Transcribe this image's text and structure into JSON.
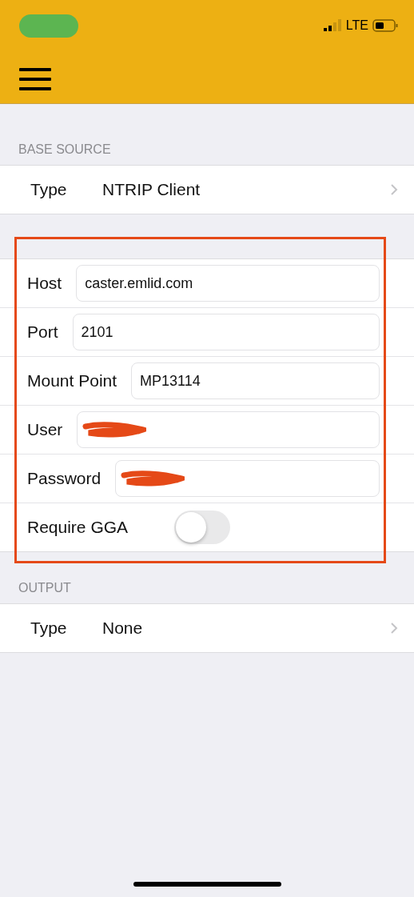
{
  "status_bar": {
    "network": "LTE"
  },
  "sections": [
    {
      "header": "BASE SOURCE",
      "row": {
        "label": "Type",
        "value": "NTRIP Client"
      }
    }
  ],
  "fields": [
    {
      "kind": "text",
      "label": "Host",
      "value": "caster.emlid.com"
    },
    {
      "kind": "text",
      "label": "Port",
      "value": "2101"
    },
    {
      "kind": "text",
      "label": "Mount Point",
      "value": "MP13114"
    },
    {
      "kind": "redacted",
      "label": "User"
    },
    {
      "kind": "redacted",
      "label": "Password"
    },
    {
      "kind": "switch",
      "label": "Require GGA",
      "on": false
    }
  ],
  "output": {
    "header": "OUTPUT",
    "row": {
      "label": "Type",
      "value": "None"
    }
  }
}
